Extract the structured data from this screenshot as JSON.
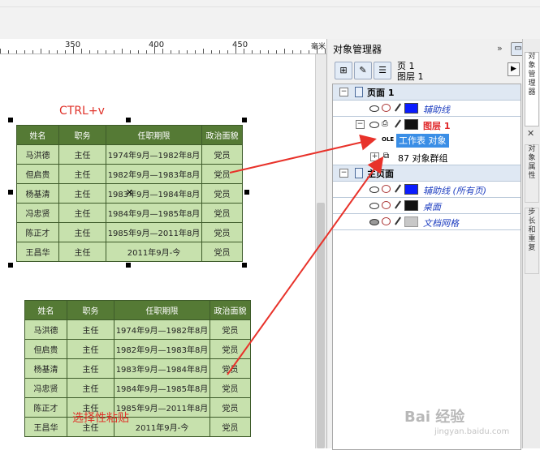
{
  "ruler": {
    "marks": [
      "350",
      "400",
      "450"
    ],
    "unit": "毫米"
  },
  "canvas": {
    "ctrl_v_label": "CTRL+v",
    "paste_special_label": "选择性粘贴",
    "table1": {
      "headers": [
        "姓名",
        "职务",
        "任职期限",
        "政治面貌"
      ],
      "rows": [
        [
          "马洪德",
          "主任",
          "1974年9月—1982年8月",
          "党员"
        ],
        [
          "但启贵",
          "主任",
          "1982年9月—1983年8月",
          "党员"
        ],
        [
          "杨基清",
          "主任",
          "1983年9月—1984年8月",
          "党员"
        ],
        [
          "冯忠贤",
          "主任",
          "1984年9月—1985年8月",
          "党员"
        ],
        [
          "陈正才",
          "主任",
          "1985年9月—2011年8月",
          "党员"
        ],
        [
          "王昌华",
          "主任",
          "2011年9月-今",
          "党员"
        ]
      ]
    },
    "table2": {
      "headers": [
        "姓名",
        "职务",
        "任职期限",
        "政治面貌"
      ],
      "rows": [
        [
          "马洪德",
          "主任",
          "1974年9月—1982年8月",
          "党员"
        ],
        [
          "但启贵",
          "主任",
          "1982年9月—1983年8月",
          "党员"
        ],
        [
          "杨基清",
          "主任",
          "1983年9月—1984年8月",
          "党员"
        ],
        [
          "冯忠贤",
          "主任",
          "1984年9月—1985年8月",
          "党员"
        ],
        [
          "陈正才",
          "主任",
          "1985年9月—2011年8月",
          "党员"
        ],
        [
          "王昌华",
          "主任",
          "2011年9月-今",
          "党员"
        ]
      ]
    }
  },
  "docker": {
    "title": "对象管理器",
    "page_label": "页 1",
    "layer_label": "图层 1",
    "tree": {
      "page1": "页面 1",
      "guides": "辅助线",
      "layer1": "图层 1",
      "ole_tag": "OLE",
      "worksheet_object": "工作表 对象",
      "group": "87 对象群组",
      "master_page": "主页面",
      "master_guides": "辅助线 (所有页)",
      "desktop": "桌面",
      "doc_grid": "文档网格"
    },
    "colors": {
      "blue_swatch": "#0a1cff",
      "black_swatch": "#111111",
      "grey_swatch": "#c8c8c8"
    }
  },
  "side_tabs": [
    "对象管理器",
    "对象属性",
    "步长和重复"
  ],
  "watermark": {
    "brand": "Bai 经验",
    "url": "jingyan.baidu.com"
  },
  "colors": {
    "accent_red": "#e0322a",
    "table_header": "#557a35",
    "table_cell": "#c7e1ad"
  }
}
